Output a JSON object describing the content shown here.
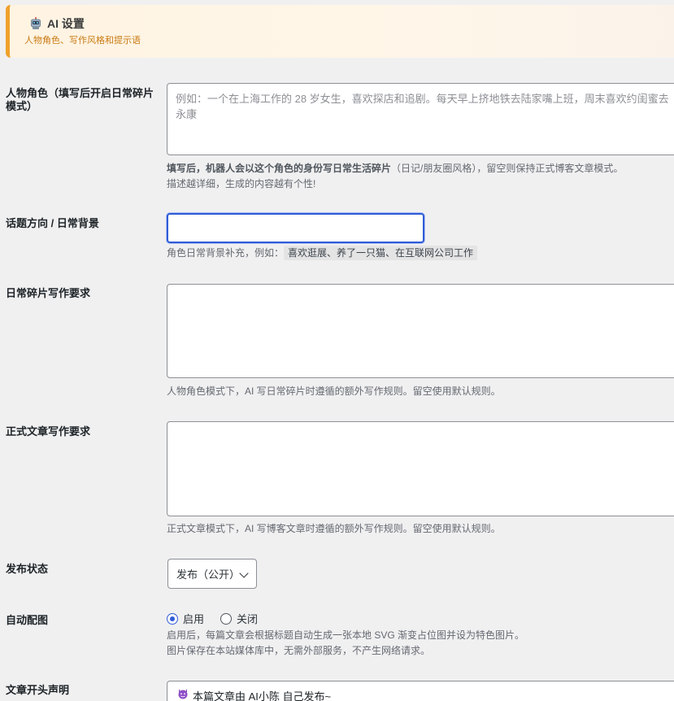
{
  "header": {
    "title": "AI 设置",
    "subtitle": "人物角色、写作风格和提示语",
    "icon": "robot-icon"
  },
  "persona": {
    "label": "人物角色（填写后开启日常碎片模式）",
    "placeholder": "例如：一个在上海工作的 28 岁女生，喜欢探店和追剧。每天早上挤地铁去陆家嘴上班，周末喜欢约闺蜜去永康",
    "value": "",
    "desc_strong": "填写后，机器人会以这个角色的身份写日常生活碎片",
    "desc_rest": "（日记/朋友圈风格），留空则保持正式博客文章模式。",
    "desc_line2": "描述越详细，生成的内容越有个性!"
  },
  "topic": {
    "label": "话题方向 / 日常背景",
    "value": "",
    "desc_prefix": "角色日常背景补充，例如：",
    "desc_example": "喜欢逛展、养了一只猫、在互联网公司工作"
  },
  "daily_rules": {
    "label": "日常碎片写作要求",
    "value": "",
    "desc": "人物角色模式下，AI 写日常碎片时遵循的额外写作规则。留空使用默认规则。"
  },
  "formal_rules": {
    "label": "正式文章写作要求",
    "value": "",
    "desc": "正式文章模式下，AI 写博客文章时遵循的额外写作规则。留空使用默认规则。"
  },
  "publish": {
    "label": "发布状态",
    "selected": "发布（公开）"
  },
  "auto_image": {
    "label": "自动配图",
    "options": [
      {
        "label": "启用",
        "checked": true
      },
      {
        "label": "关闭",
        "checked": false
      }
    ],
    "desc_line1": "启用后，每篇文章会根据标题自动生成一张本地 SVG 渐变占位图并设为特色图片。",
    "desc_line2": "图片保存在本站媒体库中，无需外部服务，不产生网络请求。"
  },
  "statement": {
    "label": "文章开头声明",
    "text": "本篇文章由 AI小陈 自己发布~",
    "icon": "devil-emoji-icon"
  },
  "colors": {
    "accent": "#2f5bd6",
    "banner_border": "#f0a12c",
    "subtitle": "#c87a12"
  }
}
